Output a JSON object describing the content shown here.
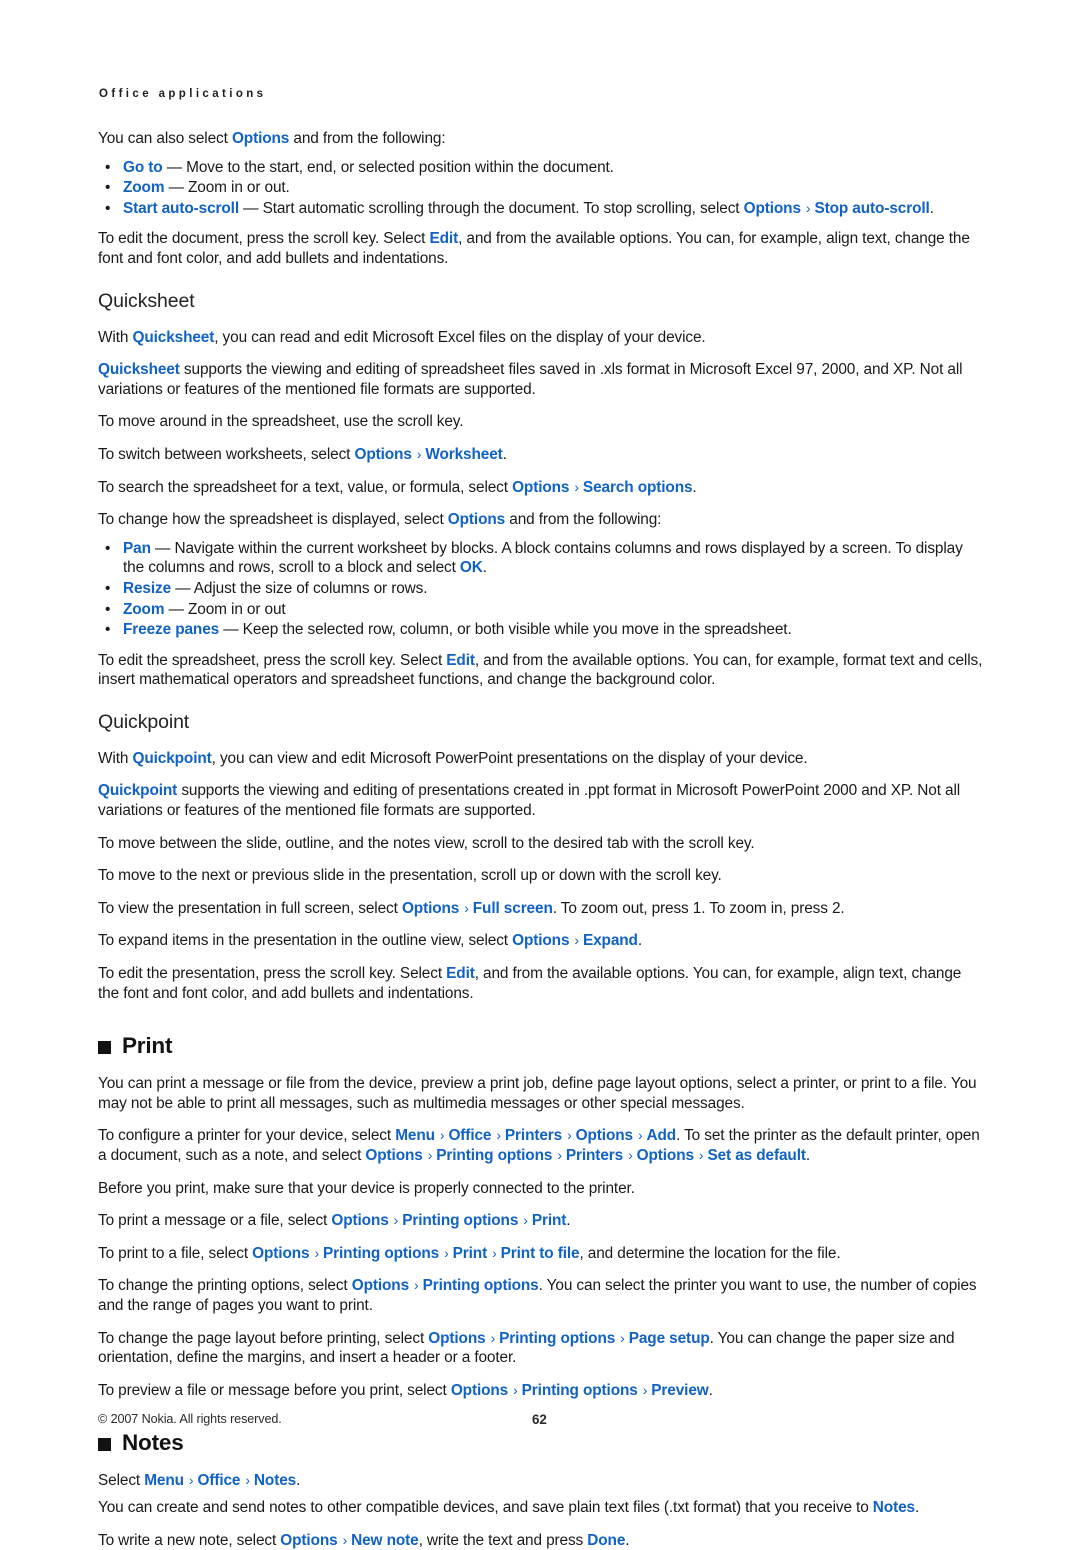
{
  "running_head": "Office applications",
  "colors": {
    "link_blue": "#1062c4",
    "text": "#1a1a1a",
    "heading": "#121212"
  },
  "separator": "›",
  "intro": {
    "lead": {
      "before": "You can also select ",
      "kw": "Options",
      "after": " and from the following:"
    },
    "bullets": [
      {
        "bullet": "•",
        "kw": "Go to",
        "text": " — Move to the start, end, or selected position within the document."
      },
      {
        "bullet": "•",
        "kw": "Zoom",
        "text": " — Zoom in or out."
      },
      {
        "bullet": "•",
        "kw": "Start auto-scroll",
        "text": " — Start automatic scrolling through the document. To stop scrolling, select ",
        "kw2": "Options",
        "kw3": "Stop auto-scroll",
        "tail": "."
      }
    ],
    "edit_doc": {
      "p1": "To edit the document, press the scroll key. Select ",
      "kw": "Edit",
      "p2": ", and from the available options. You can, for example, align text, change the font and font color, and add bullets and indentations."
    }
  },
  "quicksheet": {
    "heading": "Quicksheet",
    "with_line": {
      "p1": "With ",
      "kw": "Quicksheet",
      "p2": ", you can read and edit Microsoft Excel files on the display of your device."
    },
    "supports": {
      "kw": "Quicksheet",
      "p1": " supports the viewing and editing of spreadsheet files saved in .xls format in Microsoft Excel 97, 2000, and XP. Not all variations or features of the mentioned file formats are supported."
    },
    "move_around": "To move around in the spreadsheet, use the scroll key.",
    "switch_worksheets": {
      "p1": "To switch between worksheets, select ",
      "kw": "Options",
      "kw2": "Worksheet",
      "tail": "."
    },
    "search": {
      "p1": "To search the spreadsheet for a text, value, or formula, select ",
      "kw": "Options",
      "kw2": "Search options",
      "tail": "."
    },
    "change_display": {
      "p1": "To change how the spreadsheet is displayed, select ",
      "kw": "Options",
      "p2": " and from the following:"
    },
    "bullets": [
      {
        "bullet": "•",
        "kw": "Pan",
        "text": " — Navigate within the current worksheet by blocks. A block contains columns and rows displayed by a screen. To display the columns and rows, scroll to a block and select ",
        "kw2": "OK",
        "tail": "."
      },
      {
        "bullet": "•",
        "kw": "Resize",
        "text": " — Adjust the size of columns or rows."
      },
      {
        "bullet": "•",
        "kw": "Zoom",
        "text": " — Zoom in or out"
      },
      {
        "bullet": "•",
        "kw": "Freeze panes",
        "text": " — Keep the selected row, column, or both visible while you move in the spreadsheet."
      }
    ],
    "edit_sheet": {
      "p1": "To edit the spreadsheet, press the scroll key. Select ",
      "kw": "Edit",
      "p2": ", and from the available options. You can, for example, format text and cells, insert mathematical operators and spreadsheet functions, and change the background color."
    }
  },
  "quickpoint": {
    "heading": "Quickpoint",
    "with_line": {
      "p1": "With ",
      "kw": "Quickpoint",
      "p2": ", you can view and edit Microsoft PowerPoint presentations on the display of your device."
    },
    "supports": {
      "kw": "Quickpoint",
      "p1": " supports the viewing and editing of presentations created in .ppt format in Microsoft PowerPoint 2000 and XP. Not all variations or features of the mentioned file formats are supported."
    },
    "move_views": "To move between the slide, outline, and the notes view, scroll to the desired tab with the scroll key.",
    "move_slide": "To move to the next or previous slide in the presentation, scroll up or down with the scroll key.",
    "full_screen": {
      "p1": "To view the presentation in full screen, select ",
      "kw": "Options",
      "kw2": "Full screen",
      "p2": ". To zoom out, press 1. To zoom in, press 2."
    },
    "expand": {
      "p1": "To expand items in the presentation in the outline view, select ",
      "kw": "Options",
      "kw2": "Expand",
      "tail": "."
    },
    "edit_pres": {
      "p1": "To edit the presentation, press the scroll key. Select ",
      "kw": "Edit",
      "p2": ", and from the available options. You can, for example, align text, change the font and font color, and add bullets and indentations."
    }
  },
  "print": {
    "heading": "Print",
    "intro": "You can print a message or file from the device, preview a print job, define page layout options, select a printer, or print to a file. You may not be able to print all messages, such as multimedia messages or other special messages.",
    "configure": {
      "p1": "To configure a printer for your device, select ",
      "chain1": [
        "Menu",
        "Office",
        "Printers",
        "Options",
        "Add"
      ],
      "p2": ". To set the printer as the default printer, open a document, such as a note, and select ",
      "chain2": [
        "Options",
        "Printing options",
        "Printers",
        "Options",
        "Set as default"
      ],
      "tail": "."
    },
    "before_print": "Before you print, make sure that your device is properly connected to the printer.",
    "print_msg": {
      "p1": "To print a message or a file, select ",
      "chain": [
        "Options",
        "Printing options",
        "Print"
      ],
      "tail": "."
    },
    "print_file": {
      "p1": "To print to a file, select ",
      "chain": [
        "Options",
        "Printing options",
        "Print",
        "Print to file"
      ],
      "p2": ", and determine the location for the file."
    },
    "change_opts": {
      "p1": "To change the printing options, select ",
      "chain": [
        "Options",
        "Printing options"
      ],
      "p2": ". You can select the printer you want to use, the number of copies and the range of pages you want to print."
    },
    "page_layout": {
      "p1": "To change the page layout before printing, select ",
      "chain": [
        "Options",
        "Printing options",
        "Page setup"
      ],
      "p2": ". You can change the paper size and orientation, define the margins, and insert a header or a footer."
    },
    "preview": {
      "p1": "To preview a file or message before you print, select ",
      "chain": [
        "Options",
        "Printing options",
        "Preview"
      ],
      "tail": "."
    }
  },
  "notes": {
    "heading": "Notes",
    "select": {
      "p1": "Select ",
      "chain": [
        "Menu",
        "Office",
        "Notes"
      ],
      "tail": "."
    },
    "create": {
      "p1": "You can create and send notes to other compatible devices, and save plain text files (.txt format) that you receive to ",
      "kw": "Notes",
      "tail": "."
    },
    "write": {
      "p1": "To write a new note, select ",
      "kw": "Options",
      "kw2": "New note",
      "p2": ", write the text and press ",
      "kw3": "Done",
      "tail": "."
    }
  },
  "footer": {
    "copyright": "© 2007 Nokia. All rights reserved.",
    "page_number": "62"
  }
}
